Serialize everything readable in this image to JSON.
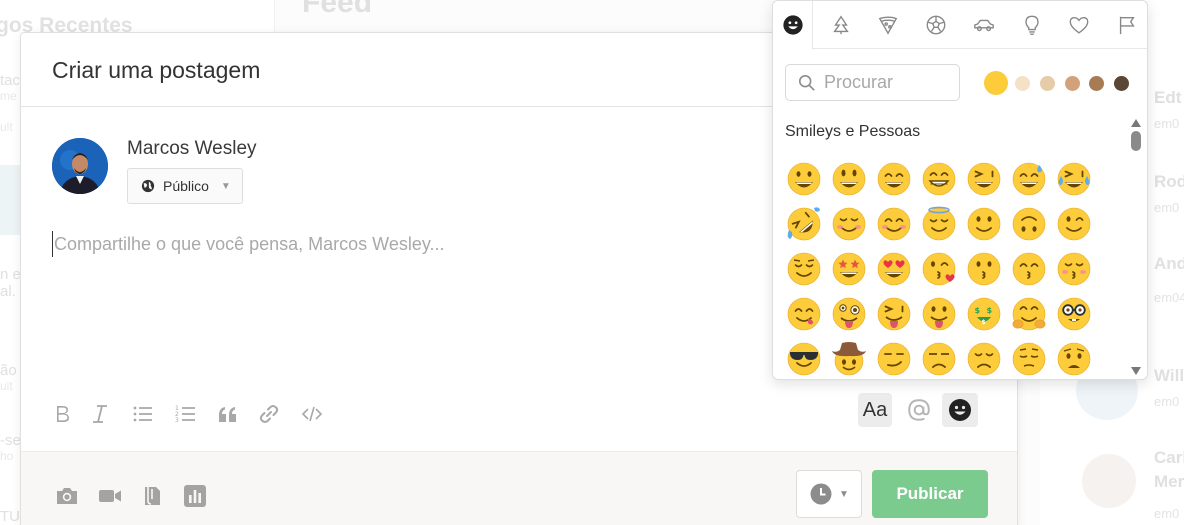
{
  "background": {
    "left_title": "gos Recentes",
    "left_rows": [
      {
        "text": "tac",
        "sub": "me"
      },
      {
        "text": "",
        "sub": "ult"
      },
      {
        "text": "n es",
        "sub": "al."
      },
      {
        "text": "ão",
        "sub": "ult"
      },
      {
        "text": "-se",
        "sub": "ho"
      },
      {
        "text": "TU",
        "sub": ""
      }
    ],
    "feed_title": "Feed",
    "contacts": [
      {
        "name": "Edt",
        "sub": "em0"
      },
      {
        "name": "Rod",
        "sub": "em0"
      },
      {
        "name": "And",
        "sub": "em04"
      },
      {
        "name": "Will",
        "sub": "em0"
      },
      {
        "name": "Carl",
        "name2": "Mer",
        "sub": "em0"
      }
    ]
  },
  "modal": {
    "title": "Criar uma postagem",
    "author_name": "Marcos Wesley",
    "privacy_label": "Público",
    "editor_placeholder": "Compartilhe o que você pensa, Marcos Wesley...",
    "text_style_label": "Aa",
    "publish_label": "Publicar"
  },
  "picker": {
    "categories": [
      "smiley-icon",
      "nature-icon",
      "food-icon",
      "activity-icon",
      "travel-icon",
      "objects-icon",
      "symbols-icon",
      "flags-icon"
    ],
    "search_placeholder": "Procurar",
    "skin_tones": [
      "#fccc3b",
      "#f5e1c7",
      "#e5cba7",
      "#d3a27a",
      "#a77c54",
      "#5b4535"
    ],
    "section_title": "Smileys e Pessoas",
    "emojis": [
      [
        "grinning",
        "smiley",
        "smile",
        "grin",
        "laughing",
        "sweat-smile",
        "joy"
      ],
      [
        "rofl",
        "relaxed",
        "blush",
        "innocent",
        "slight-smile",
        "upside-down",
        "wink"
      ],
      [
        "relieved",
        "star-struck",
        "heart-eyes",
        "kissing-heart",
        "kissing",
        "kissing-smiling-eyes",
        "kissing-closed-eyes"
      ],
      [
        "yum",
        "zany",
        "squinting-tongue",
        "tongue",
        "money-mouth",
        "hugging",
        "nerd"
      ],
      [
        "sunglasses",
        "cowboy",
        "smirk",
        "unamused",
        "disappointed",
        "pensive",
        "worried"
      ]
    ]
  },
  "colors": {
    "publish_green": "#7ccb8e",
    "emoji_yellow": "#fccc3b",
    "emoji_outline": "#e9a825"
  }
}
